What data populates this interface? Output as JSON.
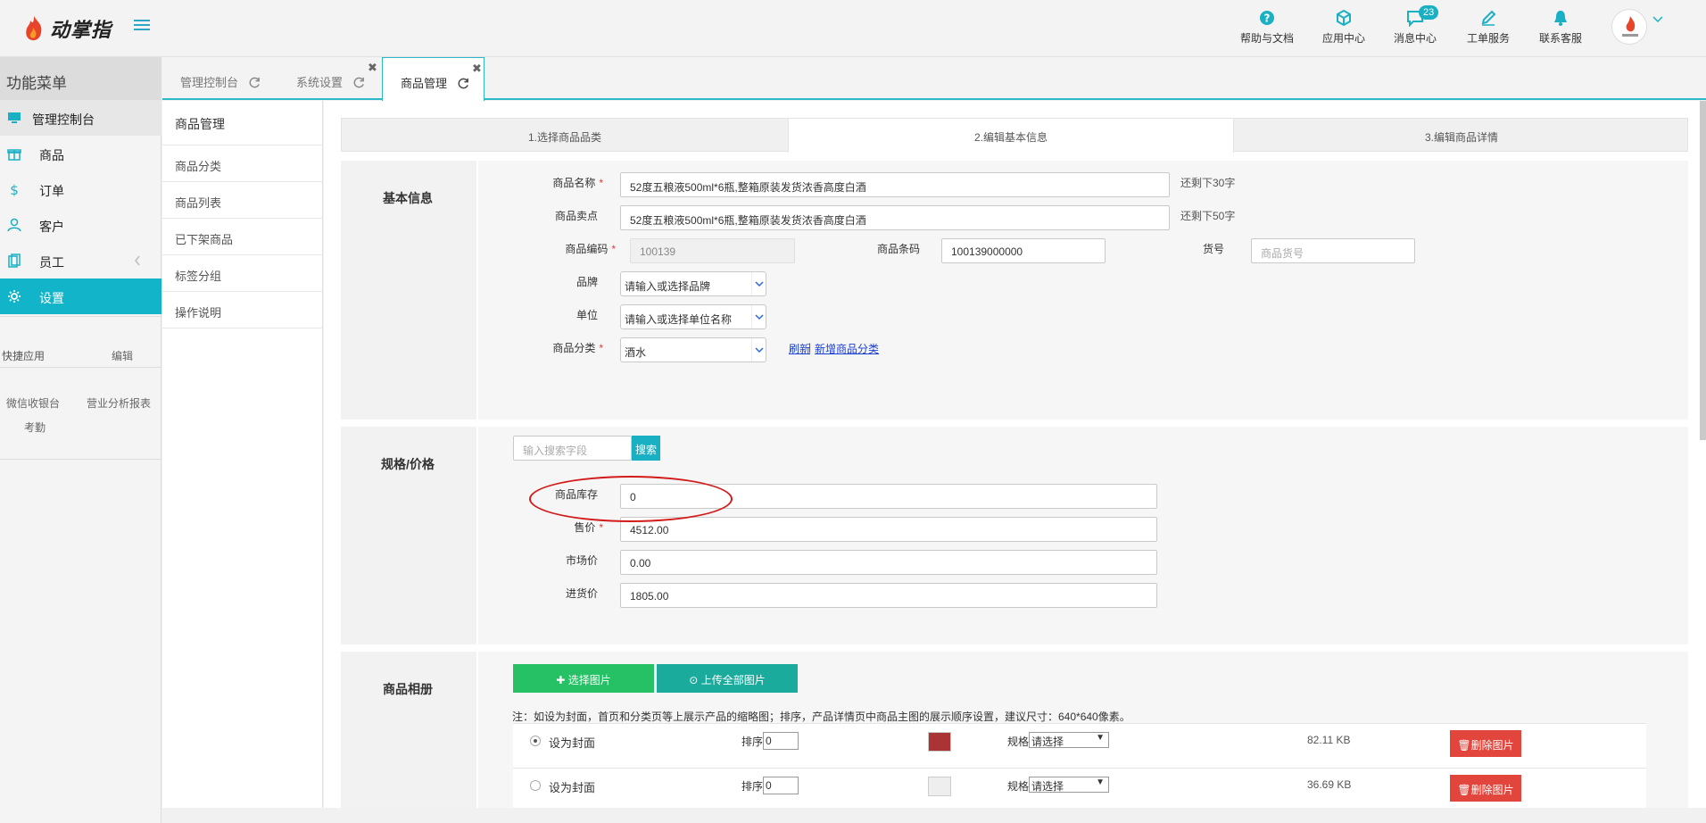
{
  "topbar": {
    "logo_text": "动掌指",
    "nav": [
      {
        "label": "帮助与文档",
        "icon": "help-icon"
      },
      {
        "label": "应用中心",
        "icon": "app-cube-icon"
      },
      {
        "label": "消息中心",
        "icon": "message-icon",
        "badge": "23"
      },
      {
        "label": "工单服务",
        "icon": "pen-icon"
      },
      {
        "label": "联系客服",
        "icon": "bell-icon"
      }
    ]
  },
  "sidebar": {
    "title": "功能菜单",
    "items": [
      {
        "label": "管理控制台",
        "icon": "monitor-icon"
      },
      {
        "label": "商品",
        "icon": "gift-icon"
      },
      {
        "label": "订单",
        "icon": "dollar-icon"
      },
      {
        "label": "客户",
        "icon": "user-icon"
      },
      {
        "label": "员工",
        "icon": "staff-icon"
      },
      {
        "label": "设置",
        "icon": "gear-icon"
      }
    ],
    "quick_apps_title": "快捷应用",
    "quick_apps_edit": "编辑",
    "quick_apps": [
      "微信收银台",
      "营业分析报表",
      "考勤"
    ]
  },
  "tabs": [
    {
      "label": "管理控制台"
    },
    {
      "label": "系统设置"
    },
    {
      "label": "商品管理"
    }
  ],
  "submenu": {
    "title": "商品管理",
    "items": [
      "商品分类",
      "商品列表",
      "已下架商品",
      "标签分组",
      "操作说明"
    ]
  },
  "steps": [
    "1.选择商品品类",
    "2.编辑基本信息",
    "3.编辑商品详情"
  ],
  "basic": {
    "section_label": "基本信息",
    "name_label": "商品名称",
    "name_value": "52度五粮液500ml*6瓶,整箱原装发货浓香高度白酒",
    "name_hint": "还剩下30字",
    "selling_label": "商品卖点",
    "selling_value": "52度五粮液500ml*6瓶,整箱原装发货浓香高度白酒",
    "selling_hint": "还剩下50字",
    "code_label": "商品编码",
    "code_value": "100139",
    "barcode_label": "商品条码",
    "barcode_value": "100139000000",
    "sku_label": "货号",
    "sku_placeholder": "商品货号",
    "brand_label": "品牌",
    "brand_value": "请输入或选择品牌",
    "unit_label": "单位",
    "unit_value": "请输入或选择单位名称",
    "category_label": "商品分类",
    "category_value": "酒水",
    "refresh_link": "刷新",
    "separator": "|",
    "new_category_link": "新增商品分类"
  },
  "spec": {
    "section_label": "规格/价格",
    "search_placeholder": "输入搜索字段",
    "search_button": "搜索",
    "stock_label": "商品库存",
    "stock_value": "0",
    "price_label": "售价",
    "price_value": "4512.00",
    "market_label": "市场价",
    "market_value": "0.00",
    "cost_label": "进货价",
    "cost_value": "1805.00"
  },
  "album": {
    "section_label": "商品相册",
    "select_button": "选择图片",
    "upload_button": "上传全部图片",
    "note": "注：如设为封面，首页和分类页等上展示产品的缩略图；排序，产品详情页中商品主图的展示顺序设置，建议尺寸：640*640像素。",
    "rows": [
      {
        "cover": "设为封面",
        "sort_label": "排序",
        "sort_value": "0",
        "spec_label": "规格",
        "spec_value": "请选择",
        "size": "82.11 KB",
        "delete": "删除图片"
      },
      {
        "cover": "设为封面",
        "sort_label": "排序",
        "sort_value": "0",
        "spec_label": "规格",
        "spec_value": "请选择",
        "size": "36.69 KB",
        "delete": "删除图片"
      }
    ]
  },
  "colors": {
    "accent": "#11b4c9",
    "required": "#e03b3b",
    "green": "#27c165",
    "teal": "#1bab9c",
    "danger": "#e2453b"
  }
}
